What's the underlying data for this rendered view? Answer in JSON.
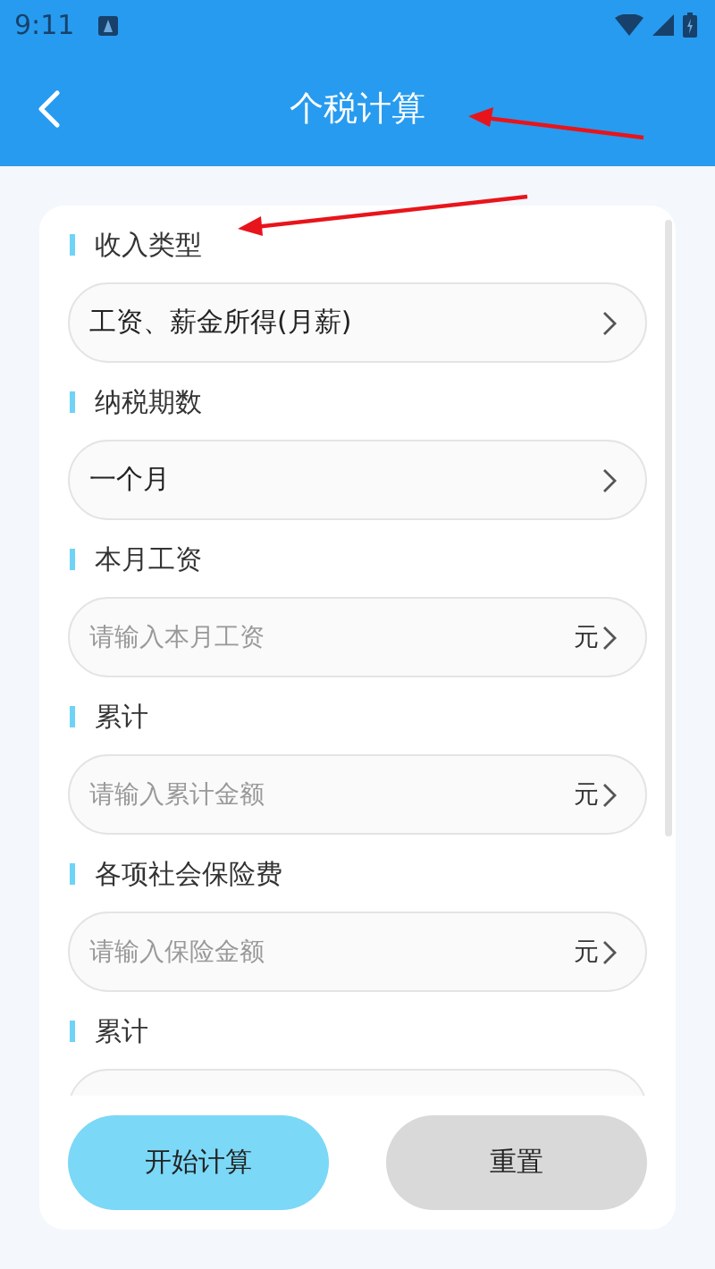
{
  "status_bar": {
    "time": "9:11"
  },
  "header": {
    "title": "个税计算"
  },
  "form": {
    "sections": [
      {
        "label": "收入类型",
        "field": {
          "kind": "select",
          "value": "工资、薪金所得(月薪)"
        }
      },
      {
        "label": "纳税期数",
        "field": {
          "kind": "select",
          "value": "一个月"
        }
      },
      {
        "label": "本月工资",
        "field": {
          "kind": "input",
          "placeholder": "请输入本月工资",
          "unit": "元"
        }
      },
      {
        "label": "累计",
        "field": {
          "kind": "input",
          "placeholder": "请输入累计金额",
          "unit": "元"
        }
      },
      {
        "label": "各项社会保险费",
        "field": {
          "kind": "input",
          "placeholder": "请输入保险金额",
          "unit": "元"
        }
      },
      {
        "label": "累计",
        "field": {
          "kind": "input"
        }
      }
    ]
  },
  "buttons": [
    {
      "label": "开始计算",
      "kind": "primary"
    },
    {
      "label": "重置",
      "kind": "secondary"
    }
  ]
}
